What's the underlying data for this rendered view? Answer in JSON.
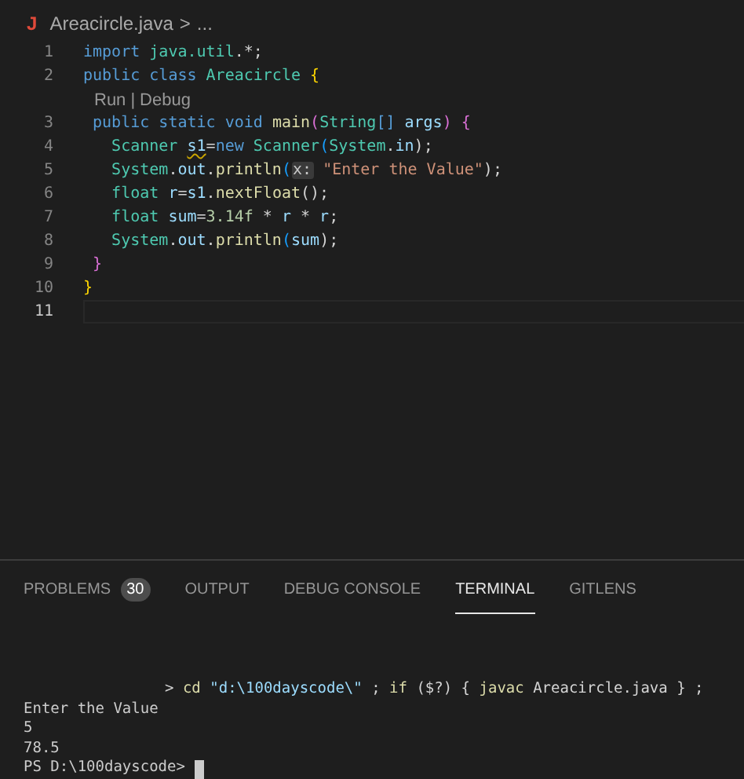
{
  "breadcrumb": {
    "file_icon": "J",
    "file": "Areacircle.java",
    "separator": ">",
    "rest": "..."
  },
  "lines": [
    {
      "kind": "code",
      "number": "1",
      "current": false,
      "tokens": [
        {
          "text": "import ",
          "kind": "keyword"
        },
        {
          "text": "java.util",
          "kind": "type"
        },
        {
          "text": ".*;",
          "kind": "plain"
        }
      ]
    },
    {
      "kind": "code",
      "number": "2",
      "current": false,
      "tokens": [
        {
          "text": "public ",
          "kind": "keyword"
        },
        {
          "text": "class ",
          "kind": "keyword"
        },
        {
          "text": "Areacircle ",
          "kind": "type"
        },
        {
          "text": "{",
          "kind": "brace"
        }
      ]
    },
    {
      "kind": "codelens",
      "links": [
        "Run",
        "Debug"
      ],
      "separator": "|"
    },
    {
      "kind": "code",
      "number": "3",
      "current": false,
      "tokens": [
        {
          "text": " public ",
          "kind": "keyword"
        },
        {
          "text": "static ",
          "kind": "keyword"
        },
        {
          "text": "void ",
          "kind": "keyword"
        },
        {
          "text": "main",
          "kind": "fn"
        },
        {
          "text": "(",
          "kind": "paren"
        },
        {
          "text": "String",
          "kind": "type"
        },
        {
          "text": "[] ",
          "kind": "keyword"
        },
        {
          "text": "args",
          "kind": "var"
        },
        {
          "text": ") {",
          "kind": "paren"
        }
      ]
    },
    {
      "kind": "code",
      "number": "4",
      "current": false,
      "tokens": [
        {
          "text": "   Scanner ",
          "kind": "type"
        },
        {
          "text": "s1",
          "kind": "warning"
        },
        {
          "text": "=",
          "kind": "plain"
        },
        {
          "text": "new ",
          "kind": "keyword"
        },
        {
          "text": "Scanner",
          "kind": "type"
        },
        {
          "text": "(",
          "kind": "bracket"
        },
        {
          "text": "System",
          "kind": "type"
        },
        {
          "text": ".",
          "kind": "plain"
        },
        {
          "text": "in",
          "kind": "var"
        },
        {
          "text": ");",
          "kind": "plain"
        }
      ]
    },
    {
      "kind": "code",
      "number": "5",
      "current": false,
      "tokens": [
        {
          "text": "   System",
          "kind": "type"
        },
        {
          "text": ".",
          "kind": "plain"
        },
        {
          "text": "out",
          "kind": "var"
        },
        {
          "text": ".",
          "kind": "plain"
        },
        {
          "text": "println",
          "kind": "fn"
        },
        {
          "text": "(",
          "kind": "bracket"
        },
        {
          "text": "x:",
          "kind": "hint"
        },
        {
          "text": " \"Enter the Value\"",
          "kind": "string"
        },
        {
          "text": ");",
          "kind": "plain"
        }
      ]
    },
    {
      "kind": "code",
      "number": "6",
      "current": false,
      "tokens": [
        {
          "text": "   float ",
          "kind": "type"
        },
        {
          "text": "r",
          "kind": "var"
        },
        {
          "text": "=",
          "kind": "plain"
        },
        {
          "text": "s1",
          "kind": "var"
        },
        {
          "text": ".",
          "kind": "plain"
        },
        {
          "text": "nextFloat",
          "kind": "fn"
        },
        {
          "text": "();",
          "kind": "plain"
        }
      ]
    },
    {
      "kind": "code",
      "number": "7",
      "current": false,
      "tokens": [
        {
          "text": "   float ",
          "kind": "type"
        },
        {
          "text": "sum",
          "kind": "var"
        },
        {
          "text": "=",
          "kind": "plain"
        },
        {
          "text": "3.14f",
          "kind": "number"
        },
        {
          "text": " * ",
          "kind": "plain"
        },
        {
          "text": "r",
          "kind": "var"
        },
        {
          "text": " * ",
          "kind": "plain"
        },
        {
          "text": "r",
          "kind": "var"
        },
        {
          "text": ";",
          "kind": "plain"
        }
      ]
    },
    {
      "kind": "code",
      "number": "8",
      "current": false,
      "tokens": [
        {
          "text": "   System",
          "kind": "type"
        },
        {
          "text": ".",
          "kind": "plain"
        },
        {
          "text": "out",
          "kind": "var"
        },
        {
          "text": ".",
          "kind": "plain"
        },
        {
          "text": "println",
          "kind": "fn"
        },
        {
          "text": "(",
          "kind": "bracket"
        },
        {
          "text": "sum",
          "kind": "var"
        },
        {
          "text": ");",
          "kind": "plain"
        }
      ]
    },
    {
      "kind": "code",
      "number": "9",
      "current": false,
      "tokens": [
        {
          "text": " }",
          "kind": "paren"
        }
      ]
    },
    {
      "kind": "code",
      "number": "10",
      "current": false,
      "tokens": [
        {
          "text": "}",
          "kind": "brace"
        }
      ]
    },
    {
      "kind": "code",
      "number": "11",
      "current": true
    }
  ],
  "panel_tabs": [
    {
      "label": "PROBLEMS",
      "badge": "30",
      "selected": false
    },
    {
      "label": "OUTPUT",
      "selected": false
    },
    {
      "label": "DEBUG CONSOLE",
      "selected": false
    },
    {
      "label": "TERMINAL",
      "selected": true
    },
    {
      "label": "GITLENS",
      "selected": false
    }
  ],
  "terminal": {
    "command": [
      {
        "text": "> ",
        "kind": "plain"
      },
      {
        "text": "cd ",
        "kind": "fn"
      },
      {
        "text": "\"d:\\100dayscode\\\"",
        "kind": "var"
      },
      {
        "text": " ; ",
        "kind": "plain"
      },
      {
        "text": "if",
        "kind": "fn"
      },
      {
        "text": " ($?) { ",
        "kind": "plain"
      },
      {
        "text": "javac",
        "kind": "fn"
      },
      {
        "text": " Areacircle.java } ;",
        "kind": "plain"
      }
    ],
    "output": [
      "Enter the Value",
      "5",
      "78.5"
    ],
    "prompt": "PS D:\\100dayscode>"
  }
}
